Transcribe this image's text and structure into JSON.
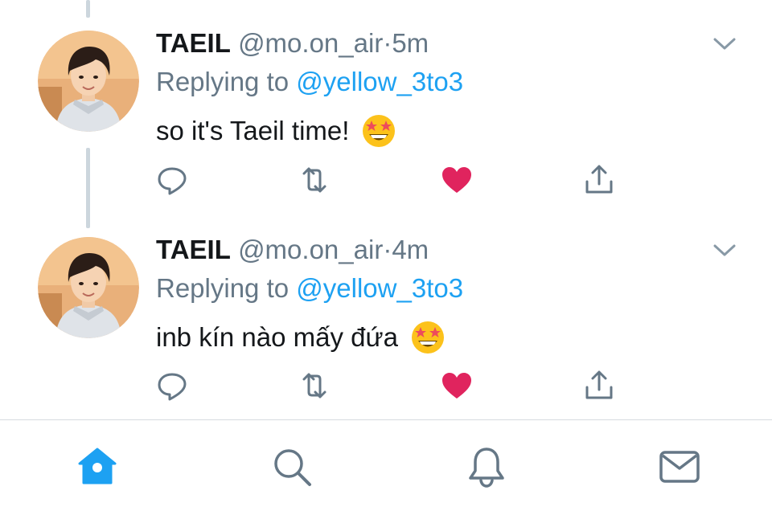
{
  "tweets": [
    {
      "name": "TAEIL",
      "handle": "@mo.on_air",
      "separator": "·",
      "time": "5m",
      "reply_prefix": "Replying to",
      "reply_to": "@yellow_3to3",
      "text": "so it's Taeil time!",
      "emoji": "star-struck-emoji",
      "liked": true
    },
    {
      "name": "TAEIL",
      "handle": "@mo.on_air",
      "separator": "·",
      "time": "4m",
      "reply_prefix": "Replying to",
      "reply_to": "@yellow_3to3",
      "text": "inb kín nào mấy đứa",
      "emoji": "star-struck-emoji",
      "liked": true
    }
  ],
  "actions": [
    "reply-icon",
    "retweet-icon",
    "like-icon",
    "share-icon"
  ],
  "tab_bar": {
    "tabs": [
      "home-icon",
      "search-icon",
      "notifications-icon",
      "messages-icon"
    ],
    "active": "home-icon"
  },
  "colors": {
    "accent": "#1da1f2",
    "like": "#e0245e",
    "secondary_text": "#657786",
    "primary_text": "#14171a",
    "thread_line": "#ccd6dd"
  }
}
